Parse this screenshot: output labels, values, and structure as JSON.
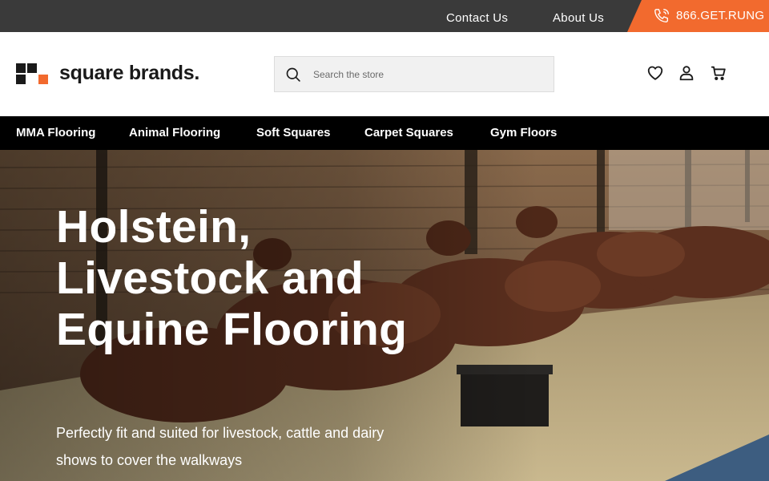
{
  "topbar": {
    "contact_label": "Contact Us",
    "about_label": "About Us",
    "phone_number": "866.GET.RUNG",
    "phone_icon": "phone-icon",
    "background_color": "#3a3a3a",
    "accent_color": "#f26a2e"
  },
  "header": {
    "logo_text": "square brands.",
    "search": {
      "placeholder": "Search the store",
      "icon": "search-icon"
    },
    "icons": [
      "heart-icon",
      "user-icon",
      "cart-icon"
    ]
  },
  "nav": {
    "items": [
      {
        "label": "MMA Flooring"
      },
      {
        "label": "Animal Flooring"
      },
      {
        "label": "Soft Squares"
      },
      {
        "label": "Carpet Squares"
      },
      {
        "label": "Gym Floors"
      }
    ]
  },
  "hero": {
    "title": "Holstein, Livestock and Equine Flooring",
    "subtitle": "Perfectly fit and suited for livestock, cattle and dairy shows to cover the walkways"
  }
}
